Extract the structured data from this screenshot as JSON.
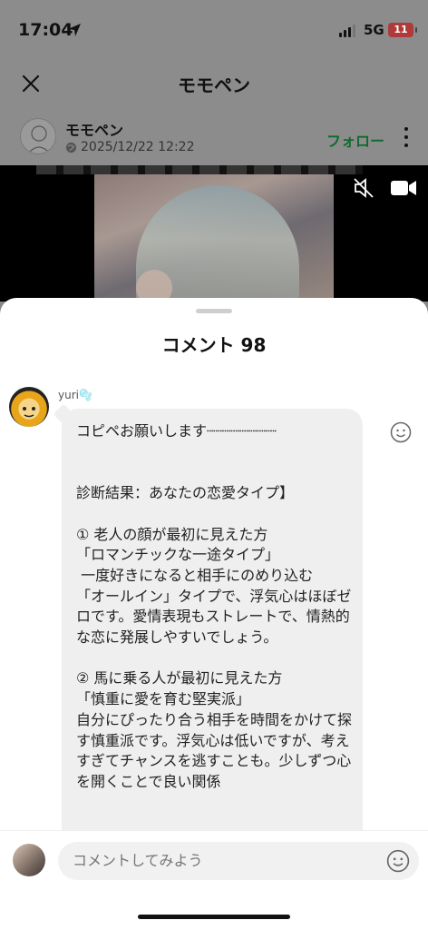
{
  "status_bar": {
    "time": "17:04",
    "network": "5G",
    "battery": "11"
  },
  "nav": {
    "title": "モモペン"
  },
  "author": {
    "name": "モモペン",
    "date": "2025/12/22 12:22",
    "follow_label": "フォロー"
  },
  "sheet": {
    "title": "コメント 98"
  },
  "comment": {
    "username": "yuri🫧",
    "text": "コピペお願いします┈┈┈┈┈┈┈┈\n\n\n診断結果：あなたの恋愛タイプ】\n\n① 老人の顔が最初に見えた方\n「ロマンチックな一途タイプ」\n 一度好きになると相手にのめり込む\n「オールイン」タイプで、浮気心はほぼゼロです。愛情表現もストレートで、情熱的な恋に発展しやすいでしょう。\n\n② 馬に乗る人が最初に見えた方\n「慎重に愛を育む堅実派」\n自分にぴったり合う相手を時間をかけて探す慎重派です。浮気心は低いですが、考えすぎてチャンスを逃すことも。少しずつ心を開くことで良い関係"
  },
  "input": {
    "placeholder": "コメントしてみよう"
  },
  "colors": {
    "follow": "#0f6b2e",
    "bubble": "#efefef",
    "battery": "#b03a3a"
  },
  "icons": [
    "location-arrow-icon",
    "close-icon",
    "globe-icon",
    "more-icon",
    "mute-icon",
    "video-camera-icon",
    "smile-icon"
  ]
}
